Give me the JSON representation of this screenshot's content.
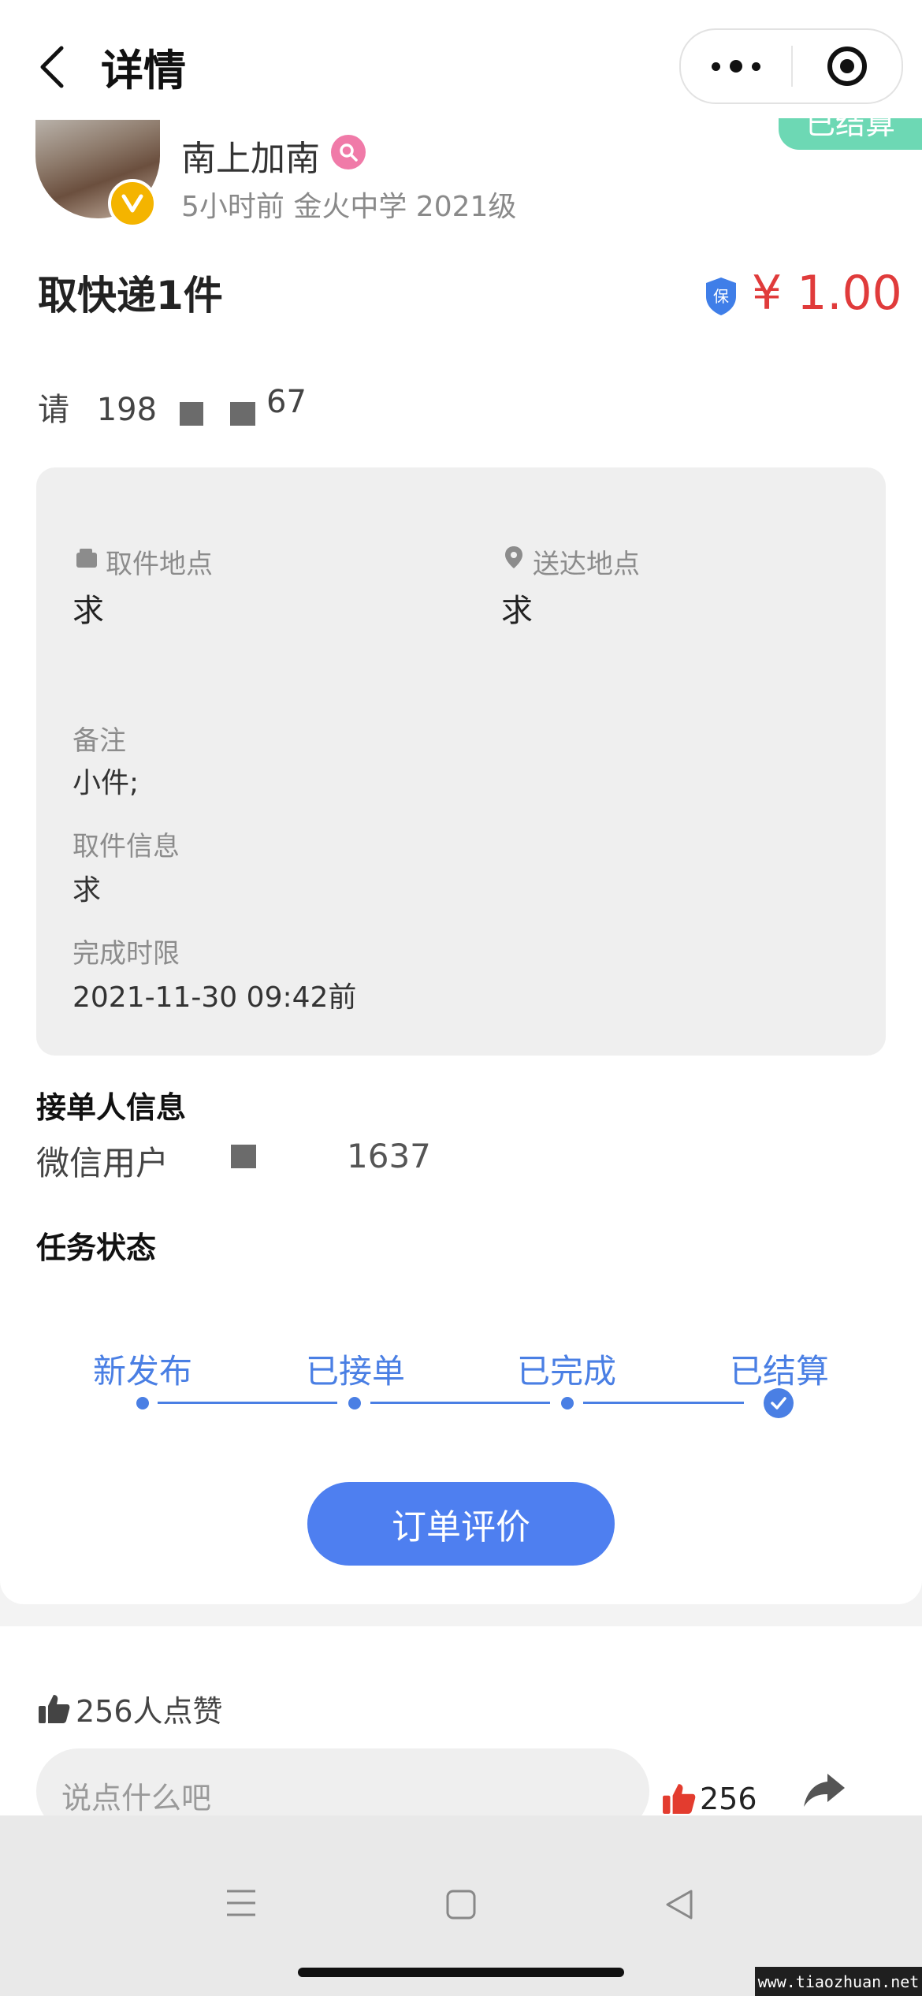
{
  "header": {
    "title": "详情"
  },
  "post": {
    "user_name": "南上加南",
    "meta": "5小时前 金火中学 2021级",
    "status_tag": "已结算",
    "title": "取快递1件",
    "price": "¥ 1.00",
    "shield_label": "保",
    "contact_prefix": "请",
    "contact_a": "198",
    "contact_b": "67"
  },
  "info": {
    "pickup_label": "取件地点",
    "pickup_value": "求",
    "dropoff_label": "送达地点",
    "dropoff_value": "求",
    "note_label": "备注",
    "note_value": "小件;",
    "pickup_info_label": "取件信息",
    "pickup_info_value": "求",
    "deadline_label": "完成时限",
    "deadline_value": "2021-11-30 09:42前"
  },
  "receiver": {
    "section_title": "接单人信息",
    "name_prefix": "微信用户",
    "name_suffix": "1637"
  },
  "task_status": {
    "section_title": "任务状态",
    "steps": [
      "新发布",
      "已接单",
      "已完成",
      "已结算"
    ],
    "current_index": 3
  },
  "actions": {
    "review_button": "订单评价"
  },
  "social": {
    "likes_text": "256人点赞",
    "comment_placeholder": "说点什么吧",
    "like_count": "256"
  },
  "colors": {
    "accent": "#4a7fe4",
    "price": "#e03b3b",
    "status_tag": "#6dd8b4",
    "vip_badge": "#f4b400"
  },
  "watermark": "www.tiaozhuan.net"
}
